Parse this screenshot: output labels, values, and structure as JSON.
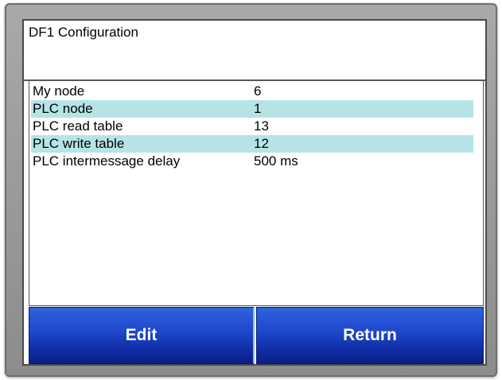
{
  "title": "DF1 Configuration",
  "rows": [
    {
      "label": "My node",
      "value": "6",
      "highlighted": false
    },
    {
      "label": "PLC node",
      "value": "1",
      "highlighted": true
    },
    {
      "label": "PLC read table",
      "value": "13",
      "highlighted": false
    },
    {
      "label": "PLC write table",
      "value": "12",
      "highlighted": true
    },
    {
      "label": "PLC intermessage delay",
      "value": "500 ms",
      "highlighted": false
    }
  ],
  "buttons": {
    "edit_label": "Edit",
    "return_label": "Return"
  },
  "colors": {
    "highlight_row": "#b6e3e6",
    "button_blue": "#1d46c9"
  }
}
